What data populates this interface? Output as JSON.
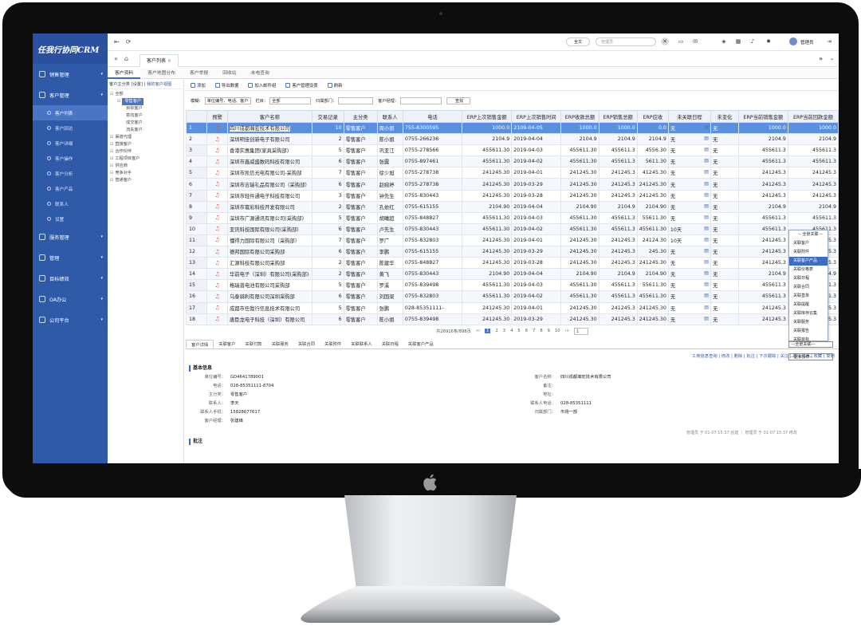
{
  "app": {
    "logo": "任我行协同CRM"
  },
  "sidebar": {
    "items": [
      {
        "type": "group",
        "label": "销售管理"
      },
      {
        "type": "group",
        "label": "客户管理"
      },
      {
        "type": "sub",
        "label": "客户列表",
        "active": true
      },
      {
        "type": "sub",
        "label": "客户回访"
      },
      {
        "type": "sub",
        "label": "客户详细"
      },
      {
        "type": "sub",
        "label": "客户操作"
      },
      {
        "type": "sub",
        "label": "客户分析"
      },
      {
        "type": "sub",
        "label": "客户产品"
      },
      {
        "type": "sub",
        "label": "联系人"
      },
      {
        "type": "sub",
        "label": "设置"
      },
      {
        "type": "group",
        "label": "服务管理"
      },
      {
        "type": "group",
        "label": "管理"
      },
      {
        "type": "group",
        "label": "目标绩效"
      },
      {
        "type": "group",
        "label": "OA办公"
      },
      {
        "type": "group",
        "label": "公司平台"
      }
    ]
  },
  "topbar": {
    "lang": "全文",
    "search_placeholder": "管理员",
    "user": "管理员"
  },
  "tabs": {
    "active": "客户列表"
  },
  "subtabs": [
    "客户资料",
    "客户地图分布",
    "客户举报",
    "回收站",
    "未电查询"
  ],
  "tree": {
    "head": "客户主分类 [设置]",
    "head_link": "我的客户视图",
    "nodes": [
      {
        "label": "全部",
        "indent": 0
      },
      {
        "label": "零售客户",
        "indent": 1,
        "sel": true
      },
      {
        "label": "目标客户",
        "indent": 2
      },
      {
        "label": "意向客户",
        "indent": 2
      },
      {
        "label": "成交客户",
        "indent": 2
      },
      {
        "label": "流失客户",
        "indent": 2
      },
      {
        "label": "渠道代理",
        "indent": 0
      },
      {
        "label": "直接客户",
        "indent": 0
      },
      {
        "label": "合作伙伴",
        "indent": 0
      },
      {
        "label": "工程项目客户",
        "indent": 0
      },
      {
        "label": "供应商",
        "indent": 0
      },
      {
        "label": "竞争对手",
        "indent": 0
      },
      {
        "label": "普通客户",
        "indent": 0
      }
    ]
  },
  "toolbar": [
    "添加",
    "导出数据",
    "加入邮件组",
    "客户管理设置",
    "刷新"
  ],
  "filter": {
    "k1": "模糊：",
    "v1": "单位编号、电话、客户",
    "k2": "栏目：",
    "v2": "全部",
    "k3": "归属部门：",
    "v3": "",
    "k4": "客户经理：",
    "v4": "",
    "btn": "查找"
  },
  "grid": {
    "headers": [
      "",
      "预警",
      "客户名称",
      "交易记录",
      "主分类",
      "联系人",
      "电话",
      "ERP上次销售金额",
      "ERP上次销售时间",
      "ERP收款总额",
      "ERP销售总额",
      "ERP应收",
      "未关联日程",
      "未变化",
      "ERP当前销售金额",
      "ERP当前回款金额"
    ],
    "rows": [
      [
        "1",
        "",
        "四川成都瀚宏技术有限公司",
        "10",
        "零售客户",
        "周小姐",
        "755-8300595",
        "1000.0",
        "2109-04-05",
        "1000.0",
        "1000.0",
        "0.0",
        "无",
        "无",
        "1000.0",
        "1000.0"
      ],
      [
        "2",
        "",
        "深圳明佳创新电子有限公司",
        "2",
        "零售客户",
        "陈小姐",
        "0755-266236",
        "2104.9",
        "2019-04-04",
        "2104.9",
        "2104.9",
        "2104.9",
        "无",
        "无",
        "2104.9",
        "2104.9"
      ],
      [
        "3",
        "",
        "香港实惠集团(家具采购部)",
        "5",
        "零售客户",
        "巩亚江",
        "0755-278566",
        "455611.30",
        "2019-04-03",
        "455611.30",
        "455611.3",
        "4556.30",
        "无",
        "无",
        "455611.3",
        "455611.3"
      ],
      [
        "4",
        "",
        "深圳市鑫威盛数码科技有限公司",
        "6",
        "零售客户",
        "张震",
        "0755-897461",
        "455611.30",
        "2019-04-02",
        "455611.30",
        "455611.3",
        "5611.30",
        "无",
        "无",
        "455611.3",
        "455611.3"
      ],
      [
        "5",
        "",
        "深圳市凯信光电有限公司-采购部",
        "7",
        "零售客户",
        "徐少旭",
        "0755-278738",
        "241245.30",
        "2019-04-01",
        "241245.30",
        "241245.3",
        "41245.30",
        "无",
        "无",
        "241245.3",
        "241245.3"
      ],
      [
        "6",
        "",
        "深圳市吉瑞礼品有限公司（采购部）",
        "6",
        "零售客户",
        "赵婉婷",
        "0755-278738",
        "241245.30",
        "2019-03-29",
        "241245.30",
        "241245.3",
        "241245.30",
        "无",
        "无",
        "241245.3",
        "241245.3"
      ],
      [
        "7",
        "",
        "深圳市轻件通电子科技有限公司",
        "3",
        "零售客户",
        "钟先生",
        "0755-830443",
        "241245.30",
        "2019-03-28",
        "241245.30",
        "241245.3",
        "241245.30",
        "无",
        "无",
        "241245.3",
        "241245.3"
      ],
      [
        "8",
        "",
        "深圳市寰彩科技开发有限公司",
        "2",
        "零售客户",
        "孔依红",
        "0755-615155",
        "2104.90",
        "2019-04-04",
        "2104.90",
        "2104.9",
        "2104.90",
        "无",
        "无",
        "2104.9",
        "2104.9"
      ],
      [
        "9",
        "",
        "深圳市广源通讯有限公司(采购部)",
        "5",
        "零售客户",
        "胡曦超",
        "0755-848827",
        "455611.30",
        "2019-04-03",
        "455611.30",
        "455611.3",
        "55611.30",
        "无",
        "无",
        "455611.3",
        "455611.3"
      ],
      [
        "10",
        "",
        "亚讯科技国际有限公司(采购部)",
        "6",
        "零售客户",
        "卢先生",
        "0755-830443",
        "455611.30",
        "2019-04-02",
        "455611.30",
        "455611.3",
        "455611.30",
        "10天",
        "无",
        "455611.3",
        "455611.3"
      ],
      [
        "11",
        "",
        "懂得力国际有限公司（采购部）",
        "7",
        "零售客户",
        "罗广",
        "0755-832803",
        "241245.30",
        "2019-04-01",
        "241245.30",
        "241245.3",
        "24124.30",
        "10天",
        "无",
        "241245.3",
        "241245.3"
      ],
      [
        "12",
        "",
        "德邦国际有限公司采购部",
        "6",
        "零售客户",
        "李鹏",
        "0755-615155",
        "241245.30",
        "2019-03-29",
        "241245.30",
        "241245.3",
        "245.30",
        "无",
        "无",
        "241245.3",
        "241245.3"
      ],
      [
        "13",
        "",
        "汇源科技有限公司采购部",
        "2",
        "零售客户",
        "陈建华",
        "0755-848827",
        "241245.30",
        "2019-03-28",
        "241245.30",
        "241245.3",
        "241245.30",
        "无",
        "无",
        "241245.3",
        "241245.3"
      ],
      [
        "14",
        "",
        "华前电子（深圳）有限公司(采购部)",
        "2",
        "零售客户",
        "黄飞",
        "0755-830443",
        "2104.90",
        "2019-04-04",
        "2104.90",
        "2104.9",
        "2104.90",
        "无",
        "无",
        "2104.9",
        "2104.9"
      ],
      [
        "15",
        "",
        "格瑞普电池有限公司采购部",
        "5",
        "零售客户",
        "罗溪",
        "0755-839498",
        "455611.30",
        "2019-04-03",
        "455611.30",
        "455611.3",
        "55611.30",
        "无",
        "无",
        "455611.3",
        "455611.3"
      ],
      [
        "16",
        "",
        "乌泰骑利有限公司深圳采购部",
        "6",
        "零售客户",
        "刘国梁",
        "0755-832803",
        "455611.30",
        "2019-04-02",
        "455611.30",
        "455611.3",
        "455611.30",
        "无",
        "无",
        "455611.3",
        "455611.3"
      ],
      [
        "17",
        "",
        "成都市任我行信息技术有限公司",
        "5",
        "零售客户",
        "张鹏",
        "028-85351111-",
        "241245.30",
        "2019-04-01",
        "241245.30",
        "241245.3",
        "241245.30",
        "无",
        "无",
        "241245.3",
        "241245.3"
      ],
      [
        "18",
        "",
        "唐臣龙电子科技（深圳）有限公司",
        "6",
        "零售客户",
        "陈小姐",
        "0755-839498",
        "241245.30",
        "2019-03-29",
        "241245.30",
        "241245.3",
        "241245.30",
        "无",
        "无",
        "241245.3",
        "241245.3"
      ]
    ]
  },
  "pager": {
    "summary": "共26916条/898页",
    "pages": [
      "1",
      "2",
      "3",
      "4",
      "5",
      "6",
      "7",
      "8",
      "9",
      "10"
    ],
    "go": "1"
  },
  "rel_menu": {
    "title": "-- 全景关联 --",
    "items": [
      "关联客户",
      "关联附件",
      "关联客户产品",
      "关联价格表",
      "关联日程",
      "关联合同",
      "关联直单",
      "关联提醒",
      "关联库存云集",
      "关联服务",
      "关联报告",
      "关联目标"
    ],
    "selected": "关联客户产品",
    "select": "---全景关联---"
  },
  "detail": {
    "tabs": [
      "客户详情",
      "关联客户",
      "关联付款",
      "关联服务",
      "关联合同",
      "关联附件",
      "关联联系人",
      "关联日程",
      "关联客户产品"
    ],
    "actions": [
      "工商信息查询",
      "修改",
      "删除",
      "批注",
      "下次跟踪",
      "关注",
      "邀请沟通",
      "收藏",
      "复制"
    ],
    "more": "--更多操作--",
    "section": "基本信息",
    "left": [
      [
        "单位编号：",
        "GD4641789001"
      ],
      [
        "电话：",
        "028-85351111-8704"
      ],
      [
        "主分类：",
        "零售客户"
      ],
      [
        "联系人：",
        "李天"
      ],
      [
        "联系人手机：",
        "15828677617"
      ],
      [
        "客户经理：",
        "张建峰"
      ]
    ],
    "right": [
      [
        "客户名称：",
        "四川成都瀚宏技术有限公司"
      ],
      [
        "备注：",
        ""
      ],
      [
        "地址：",
        ""
      ],
      [
        "联系人电话：",
        "028-85351111"
      ],
      [
        "归属部门：",
        "市场一部"
      ]
    ],
    "footnote": "管理员 于 01-07 15:37 创建 ｜ 管理员 于 01-07 15:37 修改",
    "remark": "批注"
  }
}
